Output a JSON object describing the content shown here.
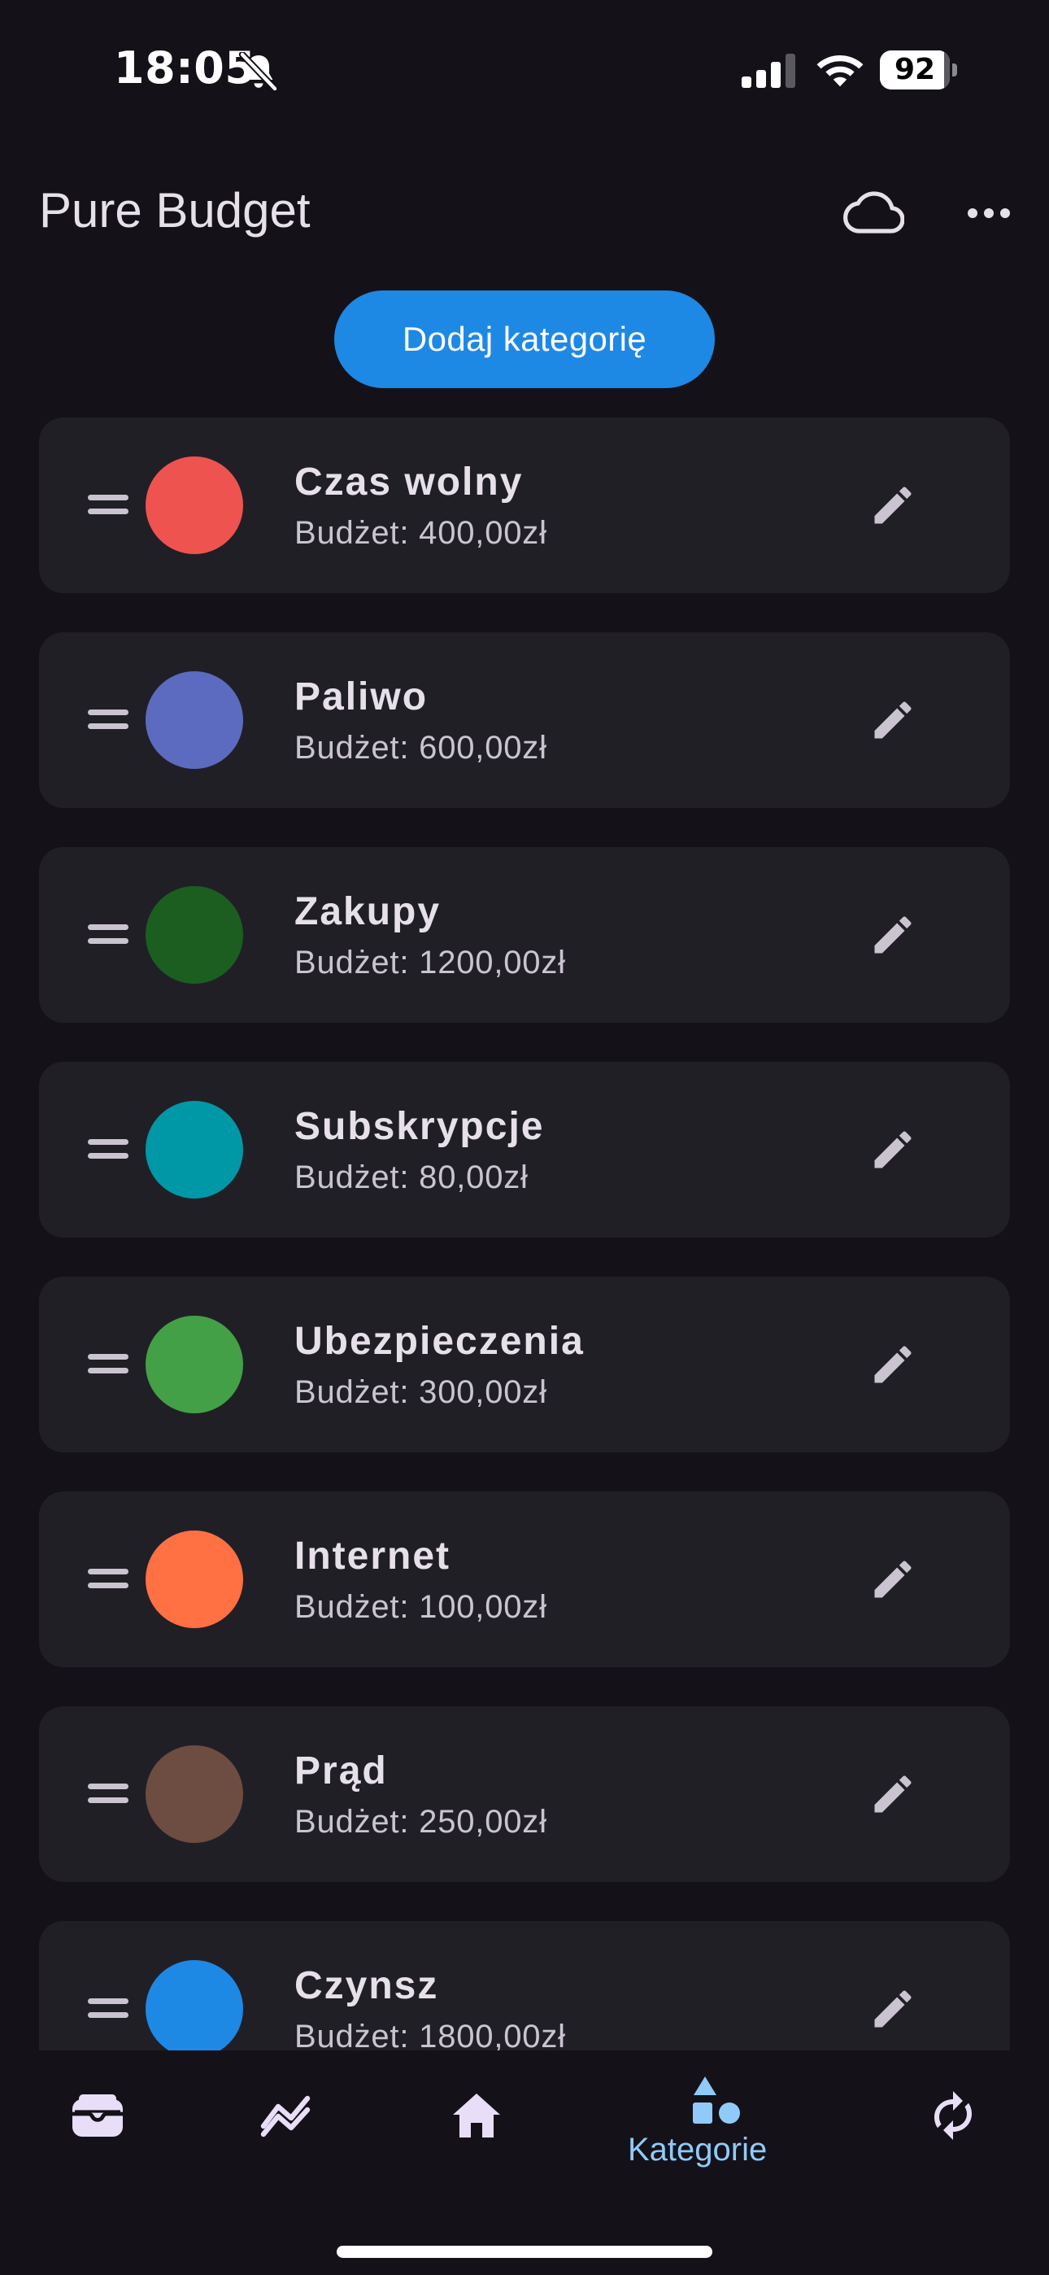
{
  "status_bar": {
    "time": "18:05",
    "battery_level": "92",
    "battery_fraction": 0.92,
    "icons": [
      "bell-slash-icon",
      "signal-icon",
      "wifi-icon",
      "battery-icon"
    ]
  },
  "app_bar": {
    "title": "Pure Budget",
    "actions": [
      "cloud-icon",
      "more-horizontal-icon"
    ]
  },
  "add_button": {
    "label": "Dodaj kategorię"
  },
  "categories": [
    {
      "name": "Czas wolny",
      "budget": "Budżet: 400,00zł",
      "color": "#EF5350"
    },
    {
      "name": "Paliwo",
      "budget": "Budżet: 600,00zł",
      "color": "#5C6BC0"
    },
    {
      "name": "Zakupy",
      "budget": "Budżet: 1200,00zł",
      "color": "#1B5E20"
    },
    {
      "name": "Subskrypcje",
      "budget": "Budżet: 80,00zł",
      "color": "#0097A7"
    },
    {
      "name": "Ubezpieczenia",
      "budget": "Budżet: 300,00zł",
      "color": "#43A047"
    },
    {
      "name": "Internet",
      "budget": "Budżet: 100,00zł",
      "color": "#FF7043"
    },
    {
      "name": "Prąd",
      "budget": "Budżet: 250,00zł",
      "color": "#6D4C41"
    },
    {
      "name": "Czynsz",
      "budget": "Budżet: 1800,00zł",
      "color": "#1E88E5"
    }
  ],
  "bottom_nav": {
    "items": [
      {
        "icon": "wallet-icon",
        "selected": false
      },
      {
        "icon": "chart-icon",
        "selected": false
      },
      {
        "icon": "home-icon",
        "selected": false
      },
      {
        "icon": "shapes-icon",
        "label": "Kategorie",
        "selected": true
      },
      {
        "icon": "sync-icon",
        "selected": false
      }
    ]
  },
  "colors": {
    "background": "#141218",
    "card": "#211F26",
    "accent": "#1E88E5",
    "selected_nav": "#90CAF9",
    "icon_inactive": "#E8DEF8"
  }
}
